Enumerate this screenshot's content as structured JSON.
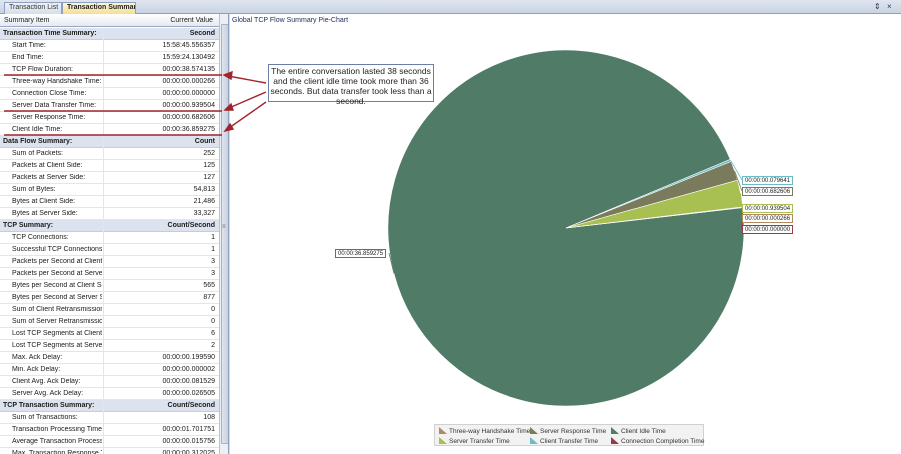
{
  "tabs": [
    {
      "label": "Transaction List"
    },
    {
      "label": "Transaction Summary"
    }
  ],
  "toolbar": {
    "pin": "⇕",
    "close": "×"
  },
  "grid": {
    "col_item": "Summary Item",
    "col_value": "Current Value",
    "rows": [
      {
        "k": "Transaction Time Summary:",
        "v": "Second",
        "section": true
      },
      {
        "k": "Start Time:",
        "v": "15:58:45.556357"
      },
      {
        "k": "End Time:",
        "v": "15:59:24.130492"
      },
      {
        "k": "TCP Flow Duration:",
        "v": "00:00:38.574135"
      },
      {
        "k": "Three-way Handshake Time:",
        "v": "00:00:00.000266"
      },
      {
        "k": "Connection Close Time:",
        "v": "00:00:00.000000"
      },
      {
        "k": "Server Data Transfer Time:",
        "v": "00:00:00.939504"
      },
      {
        "k": "Server Response Time:",
        "v": "00:00:00.682606"
      },
      {
        "k": "Client Idle Time:",
        "v": "00:00:36.859275"
      },
      {
        "k": "Data Flow Summary:",
        "v": "Count",
        "section": true
      },
      {
        "k": "Sum of Packets:",
        "v": "252"
      },
      {
        "k": "Packets at Client Side:",
        "v": "125"
      },
      {
        "k": "Packets at Server Side:",
        "v": "127"
      },
      {
        "k": "Sum of Bytes:",
        "v": "54,813"
      },
      {
        "k": "Bytes at Client Side:",
        "v": "21,486"
      },
      {
        "k": "Bytes at Server Side:",
        "v": "33,327"
      },
      {
        "k": "TCP Summary:",
        "v": "Count/Second",
        "section": true
      },
      {
        "k": "TCP Connections:",
        "v": "1"
      },
      {
        "k": "Successful TCP Connections:",
        "v": "1"
      },
      {
        "k": "Packets per Second at Client Side:",
        "v": "3"
      },
      {
        "k": "Packets per Second at Server Side:",
        "v": "3"
      },
      {
        "k": "Bytes per Second at Client Side:",
        "v": "565"
      },
      {
        "k": "Bytes per Second at Server Side:",
        "v": "877"
      },
      {
        "k": "Sum of Client Retransmission:",
        "v": "0"
      },
      {
        "k": "Sum of Server Retransmission:",
        "v": "0"
      },
      {
        "k": "Lost TCP Segments at Client Side:",
        "v": "6"
      },
      {
        "k": "Lost TCP Segments at Server Side:",
        "v": "2"
      },
      {
        "k": "Max. Ack Delay:",
        "v": "00:00:00.199590"
      },
      {
        "k": "Min. Ack Delay:",
        "v": "00:00:00.000002"
      },
      {
        "k": "Client Avg. Ack Delay:",
        "v": "00:00:00.081529"
      },
      {
        "k": "Server Avg. Ack Delay:",
        "v": "00:00:00.026505"
      },
      {
        "k": "TCP Transaction Summary:",
        "v": "Count/Second",
        "section": true
      },
      {
        "k": "Sum of Transactions:",
        "v": "108"
      },
      {
        "k": "Transaction Processing Time:",
        "v": "00:00:01.701751"
      },
      {
        "k": "Average Transaction Processing Time:",
        "v": "00:00:00.015756"
      },
      {
        "k": "Max. Transaction Response Time:",
        "v": "00:00:00.312025"
      }
    ]
  },
  "callout": {
    "text": "The entire conversation lasted 38 seconds and the client idle time took more than 36 seconds. But data transfer took less than a second."
  },
  "chart_data": {
    "type": "pie",
    "title": "Global TCP Flow Summary Pie-Chart",
    "slices": [
      {
        "name": "Client Idle Time",
        "value": 36.859275,
        "label": "00:00:36.859275",
        "color": "#4f7b67"
      },
      {
        "name": "Client Transfer Time",
        "value": 0.079641,
        "label": "00:00:00.079641",
        "color": "#6bbcc6"
      },
      {
        "name": "Server Response Time",
        "value": 0.682606,
        "label": "00:00:00.682606",
        "color": "#7a7a5c"
      },
      {
        "name": "Server Transfer Time",
        "value": 0.939504,
        "label": "00:00:00.939504",
        "color": "#a8bf52"
      },
      {
        "name": "Three-way Handshake Time",
        "value": 0.000266,
        "label": "00:00:00.000266",
        "color": "#b08a62"
      },
      {
        "name": "Connection Completion Time",
        "value": 0.0,
        "label": "00:00:00.000000",
        "color": "#9a3a44"
      }
    ],
    "legend": [
      {
        "name": "Three-way Handshake Time",
        "color": "#b08a62"
      },
      {
        "name": "Server Response Time",
        "color": "#7a7a5c"
      },
      {
        "name": "Client Idle Time",
        "color": "#4f7b67"
      },
      {
        "name": "Server Transfer Time",
        "color": "#a8bf52"
      },
      {
        "name": "Client Transfer Time",
        "color": "#6bbcc6"
      },
      {
        "name": "Connection Completion Time",
        "color": "#9a3a44"
      }
    ],
    "legend_position": "bottom"
  }
}
